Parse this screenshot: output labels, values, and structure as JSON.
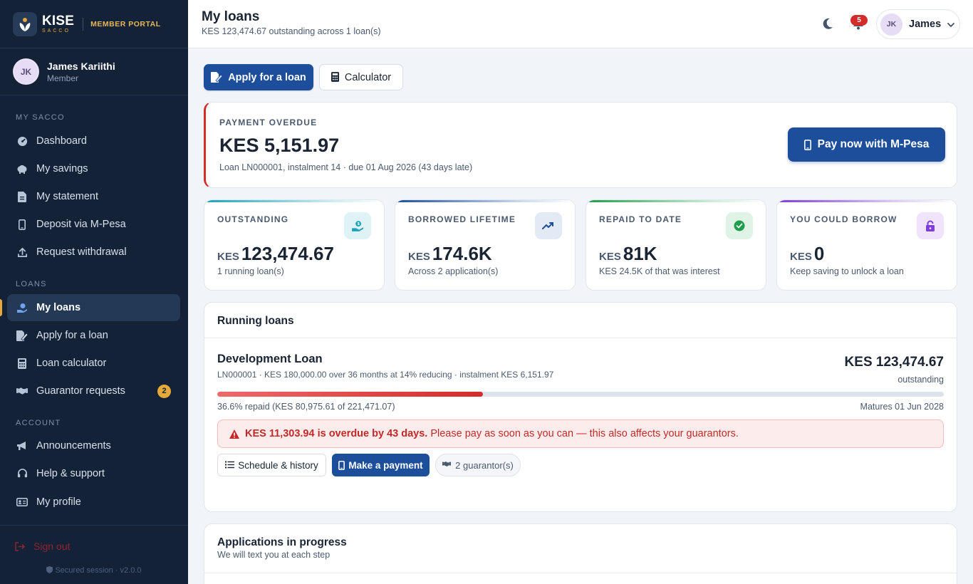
{
  "brand": {
    "name": "KISE",
    "sub": "SACCO",
    "portal": "MEMBER PORTAL"
  },
  "member": {
    "initials": "JK",
    "name": "James Kariithi",
    "role": "Member"
  },
  "nav": {
    "section_sacco": "MY SACCO",
    "dashboard": "Dashboard",
    "savings": "My savings",
    "statement": "My statement",
    "deposit": "Deposit via M-Pesa",
    "withdrawal": "Request withdrawal",
    "section_loans": "LOANS",
    "my_loans": "My loans",
    "apply": "Apply for a loan",
    "calculator": "Loan calculator",
    "guarantor": "Guarantor requests",
    "guarantor_count": "2",
    "section_account": "ACCOUNT",
    "announcements": "Announcements",
    "help": "Help & support",
    "profile": "My profile",
    "signout": "Sign out",
    "secured": "Secured session · v2.0.0"
  },
  "header": {
    "title": "My loans",
    "subtitle": "KES 123,474.67 outstanding across 1 loan(s)",
    "notifications": "5",
    "user_initials": "JK",
    "user_name": "James"
  },
  "actions": {
    "apply": "Apply for a loan",
    "calculator": "Calculator"
  },
  "overdue": {
    "label": "PAYMENT OVERDUE",
    "amount": "KES 5,151.97",
    "detail": "Loan LN000001, instalment 14 · due 01 Aug 2026 (43 days late)",
    "pay_button": "Pay now with M-Pesa"
  },
  "stats": [
    {
      "label": "OUTSTANDING",
      "currency": "KES",
      "value": "123,474.67",
      "note": "1 running loan(s)",
      "color": "#1aa3b8",
      "icon": "hand-money-icon"
    },
    {
      "label": "BORROWED LIFETIME",
      "currency": "KES",
      "value": "174.6K",
      "note": "Across 2 application(s)",
      "color": "#1d4e9c",
      "icon": "trend-up-icon"
    },
    {
      "label": "REPAID TO DATE",
      "currency": "KES",
      "value": "81K",
      "note": "KES 24.5K of that was interest",
      "color": "#1e9e4a",
      "icon": "check-circle-icon"
    },
    {
      "label": "YOU COULD BORROW",
      "currency": "KES",
      "value": "0",
      "note": "Keep saving to unlock a loan",
      "color": "#7e3fd6",
      "icon": "lock-icon"
    }
  ],
  "running": {
    "title": "Running loans",
    "loan_name": "Development Loan",
    "loan_meta": "LN000001 · KES 180,000.00 over 36 months at 14% reducing · instalment KES 6,151.97",
    "outstanding": "KES 123,474.67",
    "outstanding_label": "outstanding",
    "progress_fraction": 0.366,
    "repaid_text": "36.6% repaid (KES 80,975.61 of 221,471.07)",
    "matures": "Matures 01 Jun 2028",
    "alert_strong": "KES 11,303.94 is overdue by 43 days.",
    "alert_text": "Please pay as soon as you can — this also affects your guarantors.",
    "schedule_btn": "Schedule & history",
    "payment_btn": "Make a payment",
    "guarantors_btn": "2 guarantor(s)"
  },
  "applications": {
    "title": "Applications in progress",
    "subtitle": "We will text you at each step"
  },
  "colors": {
    "sidebar": "#132237",
    "primary": "#1d4e9c",
    "danger": "#d42b2b",
    "accent": "#e6a93a"
  }
}
